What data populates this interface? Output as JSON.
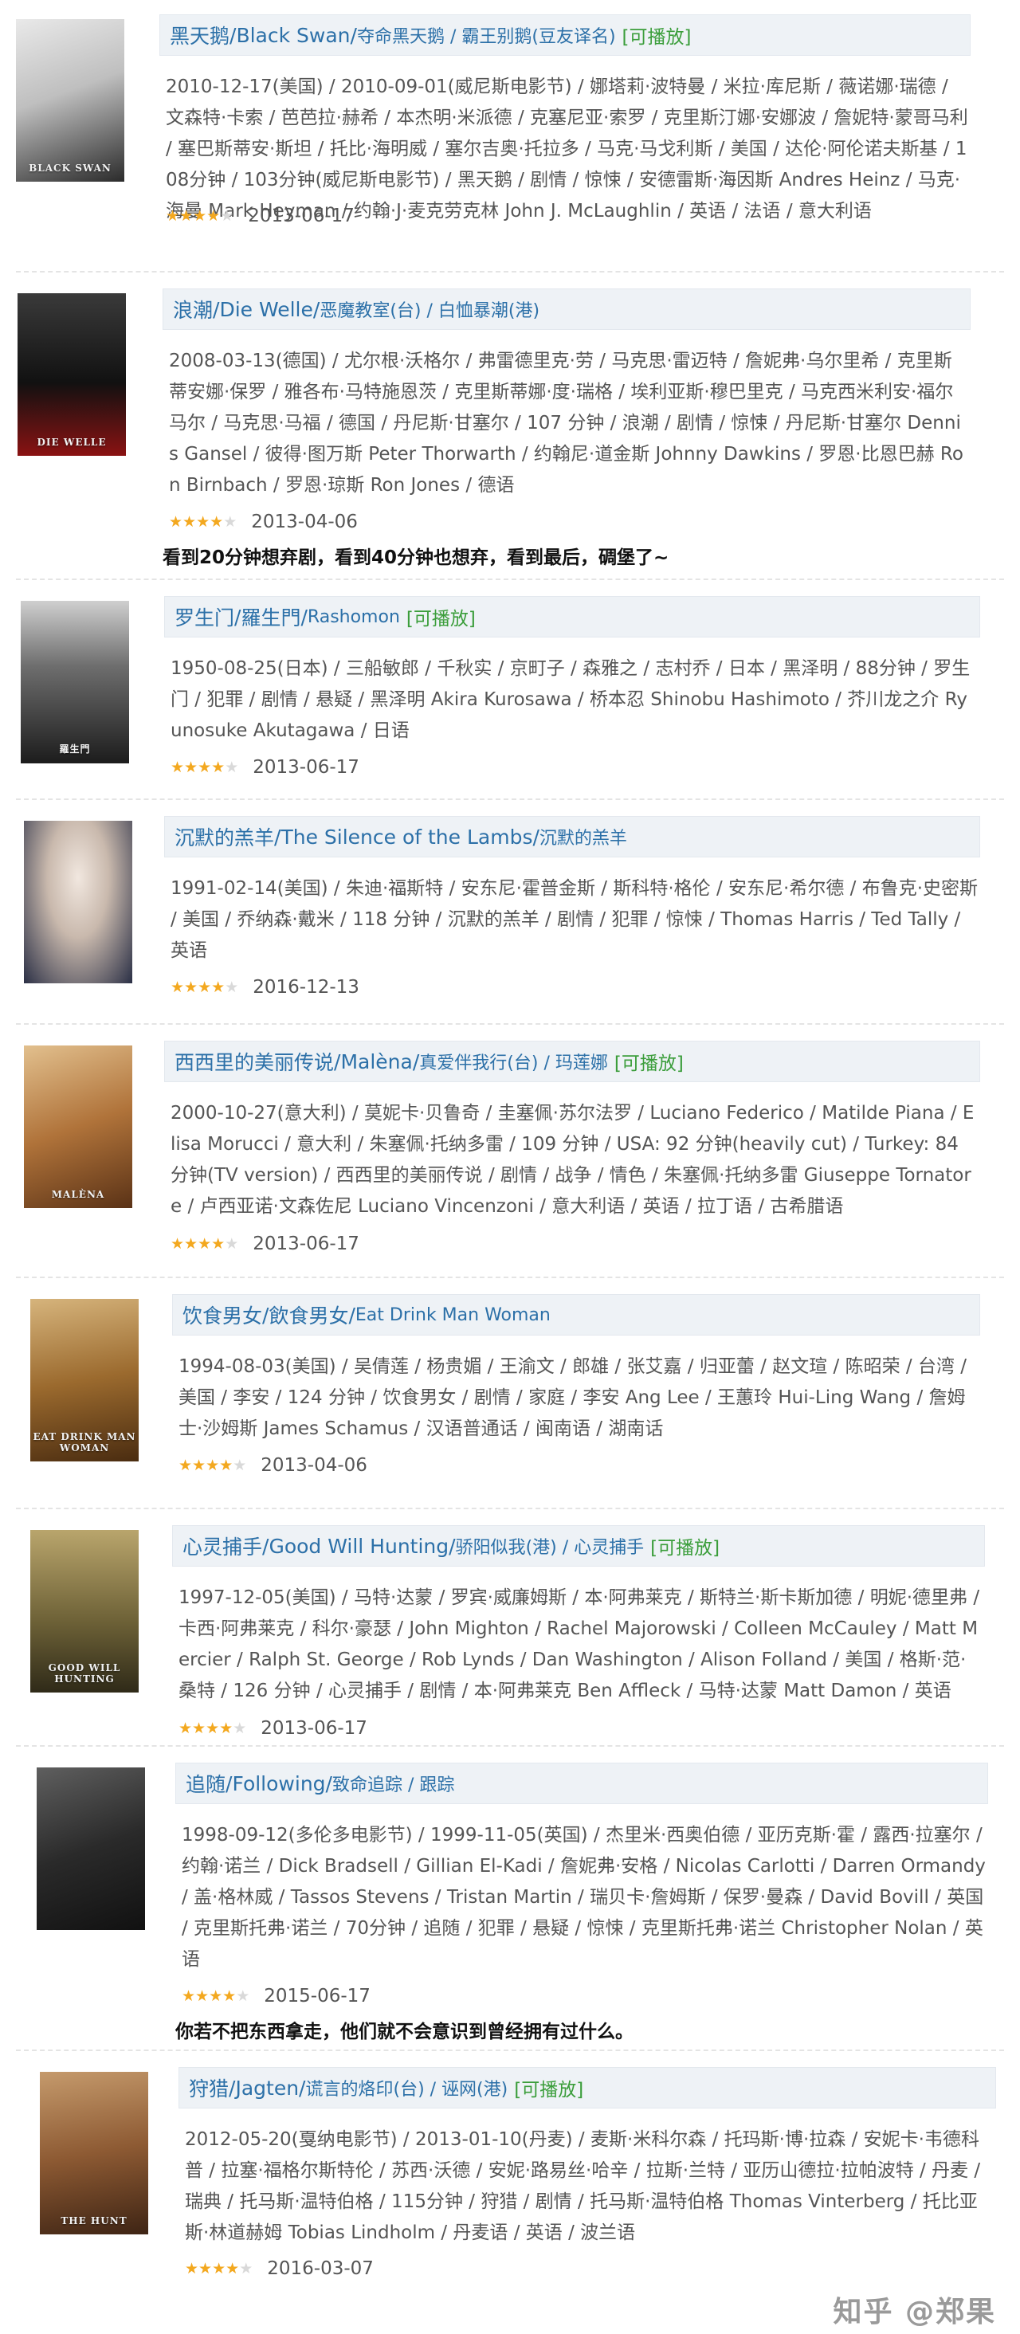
{
  "entries": [
    {
      "title": "黑天鹅",
      "alt": "Black Swan",
      "aliases": "夺命黑天鹅 / 霸王别鹅(豆友译名)",
      "play": "[可播放]",
      "info": "2010-12-17(美国) / 2010-09-01(威尼斯电影节) / 娜塔莉·波特曼 / 米拉·库尼斯 / 薇诺娜·瑞德 / 文森特·卡索 / 芭芭拉·赫希 / 本杰明·米派德 / 克塞尼亚·索罗 / 克里斯汀娜·安娜波 / 詹妮特·蒙哥马利 / 塞巴斯蒂安·斯坦 / 托比·海明威 / 塞尔吉奥·托拉多 / 马克·马戈利斯 / 美国 / 达伦·阿伦诺夫斯基 / 108分钟 / 103分钟(威尼斯电影节) / 黑天鹅 / 剧情 / 惊悚 / 安德雷斯·海因斯 Andres Heinz / 马克·海曼 Mark Heyman / 约翰·J·麦克劳克林 John J. McLaughlin / 英语 / 法语 / 意大利语",
      "rating": 4,
      "date": "2013-06-17",
      "comment": "",
      "poster": {
        "caption": "BLACK SWAN",
        "bg": "linear-gradient(160deg,#e9e9e9 0%,#bfbfbf 45%,#2b2b2b 100%)"
      }
    },
    {
      "title": "浪潮",
      "alt": "Die Welle",
      "aliases": "恶魔教室(台) / 白恤暴潮(港)",
      "play": "",
      "info": "2008-03-13(德国) / 尤尔根·沃格尔 / 弗雷德里克·劳 / 马克思·雷迈特 / 詹妮弗·乌尔里希 / 克里斯蒂安娜·保罗 / 雅各布·马特施恩茨 / 克里斯蒂娜·度·瑞格 / 埃利亚斯·穆巴里克 / 马克西米利安·福尔马尔 / 马克思·马福 / 德国 / 丹尼斯·甘塞尔 / 107 分钟 / 浪潮 / 剧情 / 惊悚 / 丹尼斯·甘塞尔 Dennis Gansel / 彼得·图万斯 Peter Thorwarth / 约翰尼·道金斯 Johnny Dawkins / 罗恩·比恩巴赫 Ron Birnbach / 罗恩·琼斯 Ron Jones / 德语",
      "rating": 4,
      "date": "2013-04-06",
      "comment": "看到20分钟想弃剧，看到40分钟也想弃，看到最后，碉堡了~",
      "poster": {
        "caption": "DIE WELLE",
        "bg": "linear-gradient(180deg,#3a3a3a 0%,#111111 55%,#8a1212 100%)"
      }
    },
    {
      "title": "罗生门",
      "alt": "羅生門",
      "aliases": "Rashomon",
      "play": "[可播放]",
      "info": "1950-08-25(日本) / 三船敏郎 / 千秋实 / 京町子 / 森雅之 / 志村乔 / 日本 / 黑泽明 / 88分钟 / 罗生门 / 犯罪 / 剧情 / 悬疑 / 黑泽明 Akira Kurosawa / 桥本忍 Shinobu Hashimoto / 芥川龙之介 Ryunosuke Akutagawa / 日语",
      "rating": 4,
      "date": "2013-06-17",
      "comment": "",
      "poster": {
        "caption": "羅生門",
        "bg": "linear-gradient(180deg,#cfcfcf 0%,#6e6e6e 40%,#1c1c1c 100%)"
      }
    },
    {
      "title": "沉默的羔羊",
      "alt": "The Silence of the Lambs",
      "aliases": "沉默的羔羊",
      "play": "",
      "info": "1991-02-14(美国) / 朱迪·福斯特 / 安东尼·霍普金斯 / 斯科特·格伦 / 安东尼·希尔德 / 布鲁克·史密斯 / 美国 / 乔纳森·戴米 / 118 分钟 / 沉默的羔羊 / 剧情 / 犯罪 / 惊悚 / Thomas Harris / Ted Tally / 英语",
      "rating": 4,
      "date": "2016-12-13",
      "comment": "",
      "poster": {
        "caption": "",
        "bg": "radial-gradient(ellipse at 50% 35%,#f1e7df 0%,#c9b9ad 40%,#2a2f45 100%)"
      }
    },
    {
      "title": "西西里的美丽传说",
      "alt": "Malèna",
      "aliases": "真爱伴我行(台) / 玛莲娜",
      "play": "[可播放]",
      "info": "2000-10-27(意大利) / 莫妮卡·贝鲁奇 / 圭塞佩·苏尔法罗 / Luciano Federico / Matilde Piana / Elisa Morucci / 意大利 / 朱塞佩·托纳多雷 / 109 分钟 / USA: 92 分钟(heavily cut) / Turkey: 84 分钟(TV version) / 西西里的美丽传说 / 剧情 / 战争 / 情色 / 朱塞佩·托纳多雷 Giuseppe Tornatore / 卢西亚诺·文森佐尼 Luciano Vincenzoni / 意大利语 / 英语 / 拉丁语 / 古希腊语",
      "rating": 4,
      "date": "2013-06-17",
      "comment": "",
      "poster": {
        "caption": "MALÈNA",
        "bg": "linear-gradient(160deg,#e2c08e 0%,#b0733a 50%,#5a3216 100%)"
      }
    },
    {
      "title": "饮食男女",
      "alt": "飲食男女",
      "aliases": "Eat Drink Man Woman",
      "play": "",
      "info": "1994-08-03(美国) / 吴倩莲 / 杨贵媚 / 王渝文 / 郎雄 / 张艾嘉 / 归亚蕾 / 赵文瑄 / 陈昭荣 / 台湾 / 美国 / 李安 / 124 分钟 / 饮食男女 / 剧情 / 家庭 / 李安 Ang Lee / 王蕙玲 Hui-Ling Wang / 詹姆士·沙姆斯 James Schamus / 汉语普通话 / 闽南语 / 湖南话",
      "rating": 4,
      "date": "2013-04-06",
      "comment": "",
      "poster": {
        "caption": "EAT DRINK MAN WOMAN",
        "bg": "linear-gradient(170deg,#d6b47c 0%,#9b6a2e 50%,#4a2c10 100%)"
      }
    },
    {
      "title": "心灵捕手",
      "alt": "Good Will Hunting",
      "aliases": "骄阳似我(港) / 心灵捕手",
      "play": "[可播放]",
      "info": "1997-12-05(美国) / 马特·达蒙 / 罗宾·威廉姆斯 / 本·阿弗莱克 / 斯特兰·斯卡斯加德 / 明妮·德里弗 / 卡西·阿弗莱克 / 科尔·豪瑟 / John Mighton / Rachel Majorowski / Colleen McCauley / Matt Mercier / Ralph St. George / Rob Lynds / Dan Washington / Alison Folland / 美国 / 格斯·范·桑特 / 126 分钟 / 心灵捕手 / 剧情 / 本·阿弗莱克 Ben Affleck / 马特·达蒙 Matt Damon / 英语",
      "rating": 4,
      "date": "2013-06-17",
      "comment": "",
      "poster": {
        "caption": "GOOD WILL HUNTING",
        "bg": "linear-gradient(180deg,#b9a56c 0%,#6f6338 55%,#2f2a18 100%)"
      }
    },
    {
      "title": "追随",
      "alt": "Following",
      "aliases": "致命追踪 / 跟踪",
      "play": "",
      "info": "1998-09-12(多伦多电影节) / 1999-11-05(英国) / 杰里米·西奥伯德 / 亚历克斯·霍 / 露西·拉塞尔 / 约翰·诺兰 / Dick Bradsell / Gillian El-Kadi / 詹妮弗·安格 / Nicolas Carlotti / Darren Ormandy / 盖·格林威 / Tassos Stevens / Tristan Martin / 瑞贝卡·詹姆斯 / 保罗·曼森 / David Bovill / 英国 / 克里斯托弗·诺兰 / 70分钟 / 追随 / 犯罪 / 悬疑 / 惊悚 / 克里斯托弗·诺兰 Christopher Nolan / 英语",
      "rating": 4,
      "date": "2015-06-17",
      "comment": "你若不把东西拿走，他们就不会意识到曾经拥有过什么。",
      "poster": {
        "caption": "",
        "bg": "linear-gradient(160deg,#5f5f5f 0%,#2a2a2a 50%,#111111 100%)"
      }
    },
    {
      "title": "狩猎",
      "alt": "Jagten",
      "aliases": "谎言的烙印(台) / 诬网(港)",
      "play": "[可播放]",
      "info": "2012-05-20(戛纳电影节) / 2013-01-10(丹麦) / 麦斯·米科尔森 / 托玛斯·博·拉森 / 安妮卡·韦德科普 / 拉塞·福格尔斯特伦 / 苏西·沃德 / 安妮·路易丝·哈辛 / 拉斯·兰特 / 亚历山德拉·拉帕波特 / 丹麦 / 瑞典 / 托马斯·温特伯格 / 115分钟 / 狩猎 / 剧情 / 托马斯·温特伯格 Thomas Vinterberg / 托比亚斯·林道赫姆 Tobias Lindholm / 丹麦语 / 英语 / 波兰语",
      "rating": 4,
      "date": "2016-03-07",
      "comment": "",
      "poster": {
        "caption": "THE HUNT",
        "bg": "linear-gradient(170deg,#c59a6c 0%,#8d5a33 50%,#3e2414 100%)"
      }
    }
  ],
  "watermark": "知乎 @郑果"
}
